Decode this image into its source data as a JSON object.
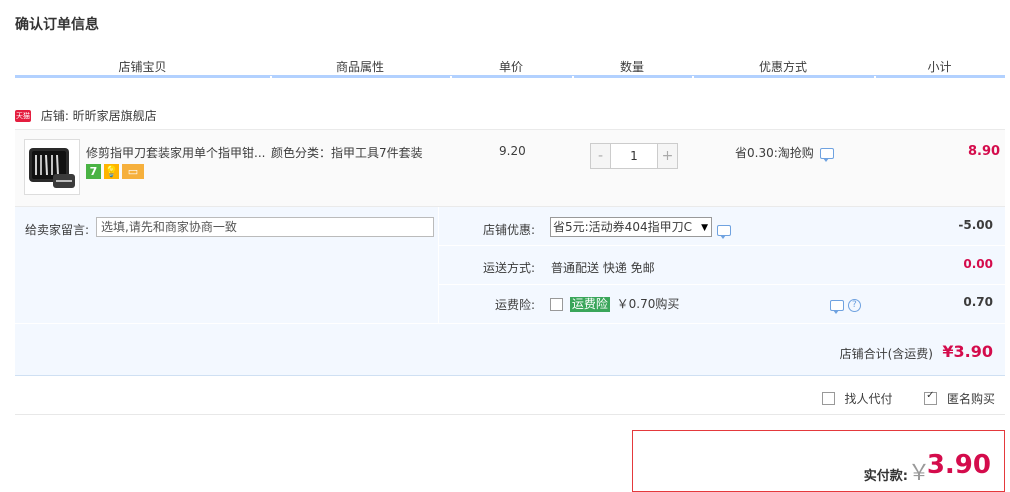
{
  "page": {
    "title": "确认订单信息"
  },
  "columns": [
    "店铺宝贝",
    "商品属性",
    "单价",
    "数量",
    "优惠方式",
    "小计"
  ],
  "shop": {
    "badge": "天猫",
    "label": "店铺: 昕昕家居旗舰店"
  },
  "item": {
    "name": "修剪指甲刀套装家用单个指甲钳...",
    "attribute": "颜色分类：指甲工具7件套装",
    "unit_price": "9.20",
    "quantity": "1",
    "minus": "-",
    "plus": "+",
    "promotion": "省0.30:淘抢购",
    "subtotal": "8.90",
    "service_icons": [
      "seven-day-return-icon",
      "bulb-icon",
      "card-icon"
    ],
    "service_icon_text": [
      "7",
      "💡",
      "▭"
    ]
  },
  "memo": {
    "label": "给卖家留言:",
    "placeholder": "选填,请先和商家协商一致"
  },
  "shop_discount": {
    "label": "店铺优惠:",
    "selected": "省5元:活动券404指甲刀C",
    "amount": "-5.00"
  },
  "shipping": {
    "label": "运送方式:",
    "value": "普通配送 快递 免邮",
    "amount": "0.00"
  },
  "insurance": {
    "label": "运费险:",
    "badge": "运费险",
    "text": "￥0.70购买",
    "amount": "0.70",
    "help": "?"
  },
  "shop_total": {
    "label": "店铺合计(含运费)",
    "amount": "¥3.90"
  },
  "options": {
    "proxy_pay": "找人代付",
    "anonymous": "匿名购买"
  },
  "pay": {
    "label": "实付款:",
    "currency": "￥",
    "amount": "3.90"
  },
  "colors": {
    "accent_red": "#d40c4c",
    "header_line": "#b2d1ff",
    "panel_bg": "#f3f8ff"
  }
}
